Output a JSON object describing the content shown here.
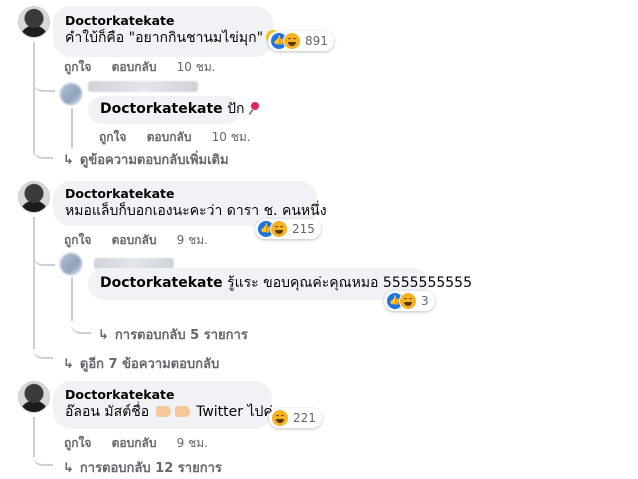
{
  "labels": {
    "like": "ถูกใจ",
    "reply": "ตอบกลับ"
  },
  "c1": {
    "author": "Doctorkatekate",
    "text": "คำใบ้ก็คือ \"อยากกินชานมไข่มุก\"",
    "reaction_count": "891",
    "time": "10 ชม.",
    "reply": {
      "author": "Doctorkatekate",
      "text": "ปัก",
      "time": "10 ชม."
    },
    "more_replies": "ดูข้อความตอบกลับเพิ่มเติม"
  },
  "c2": {
    "author": "Doctorkatekate",
    "text_line1": "หมอแล็บก็บอกเองนะคะว่า ดารา ช. คนหนึ่ง",
    "reaction_count": "215",
    "time": "9 ชม.",
    "reply": {
      "author": "Doctorkatekate",
      "text": "รู้แระ ขอบคุณค่ะคุณหมอ 5555555555",
      "reaction_count": "3"
    },
    "nested_replies": "การตอบกลับ 5 รายการ",
    "more_replies": "ดูอีก 7 ข้อความตอบกลับ"
  },
  "c3": {
    "author": "Doctorkatekate",
    "text_a": "อ๊ลอน มัสต์ชื่อ",
    "text_b": "Twitter ไปค่ะ",
    "reaction_count": "221",
    "time": "9 ชม.",
    "replies": "การตอบกลับ 12 รายการ"
  },
  "colors": {
    "like": "#1b74e4",
    "haha": "#f7b125",
    "meta": "#65676b",
    "bubble": "#f0f2f5"
  }
}
